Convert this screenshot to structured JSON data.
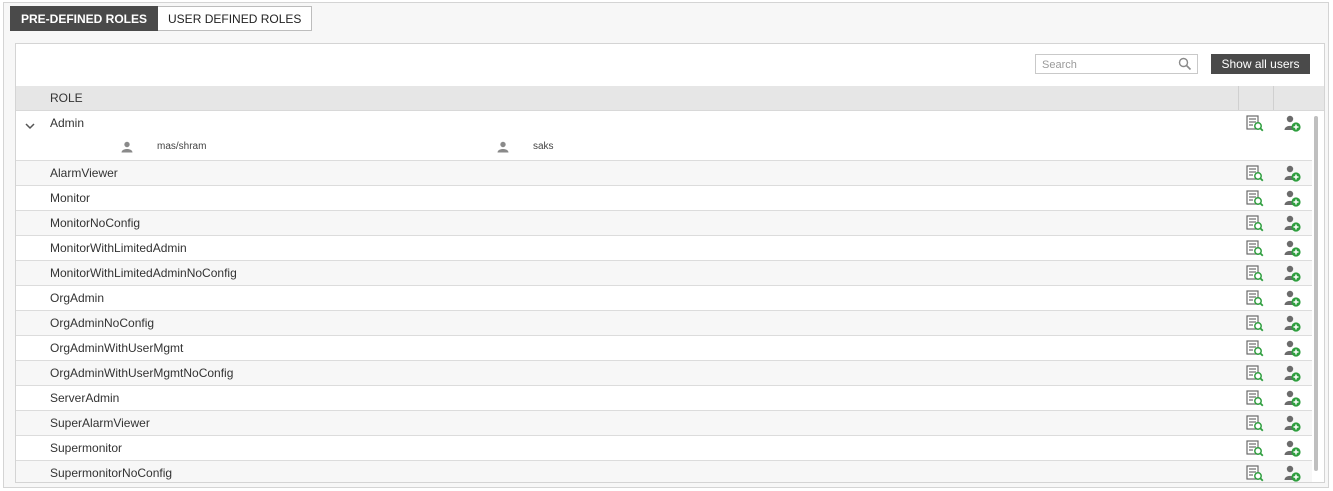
{
  "tabs": [
    {
      "label": "PRE-DEFINED ROLES",
      "active": true
    },
    {
      "label": "USER DEFINED ROLES",
      "active": false
    }
  ],
  "toolbar": {
    "search_placeholder": "Search",
    "show_all_label": "Show all users"
  },
  "table": {
    "column_role": "ROLE",
    "rows": [
      {
        "name": "Admin",
        "expanded": true,
        "members": [
          "mas/shram",
          "saks"
        ]
      },
      {
        "name": "AlarmViewer"
      },
      {
        "name": "Monitor"
      },
      {
        "name": "MonitorNoConfig"
      },
      {
        "name": "MonitorWithLimitedAdmin"
      },
      {
        "name": "MonitorWithLimitedAdminNoConfig"
      },
      {
        "name": "OrgAdmin"
      },
      {
        "name": "OrgAdminNoConfig"
      },
      {
        "name": "OrgAdminWithUserMgmt"
      },
      {
        "name": "OrgAdminWithUserMgmtNoConfig"
      },
      {
        "name": "ServerAdmin"
      },
      {
        "name": "SuperAlarmViewer"
      },
      {
        "name": "Supermonitor"
      },
      {
        "name": "SupermonitorNoConfig"
      }
    ]
  },
  "colors": {
    "tab_active_bg": "#4a4a4a",
    "button_bg": "#4a4a4a",
    "header_bg": "#e6e6e6",
    "icon_green": "#2e9e3e",
    "icon_gray": "#6b6b6b"
  },
  "icons": {
    "search": "search-icon",
    "expand": "chevron-down-icon",
    "view_role": "role-details-icon",
    "add_user": "add-user-icon",
    "member": "user-icon"
  }
}
